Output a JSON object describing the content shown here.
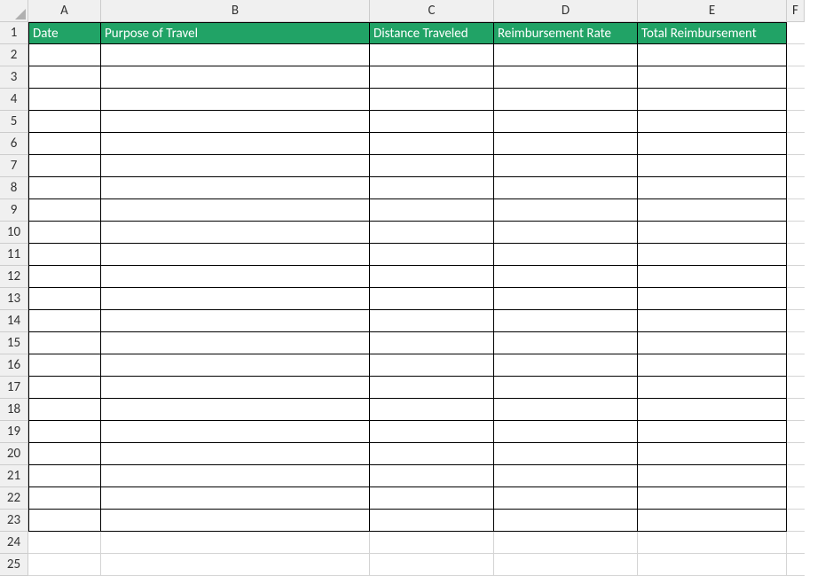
{
  "columns": [
    "A",
    "B",
    "C",
    "D",
    "E",
    "F"
  ],
  "rowCount": 25,
  "dataRowStart": 2,
  "dataRowEnd": 23,
  "headers": {
    "A": "Date",
    "B": "Purpose of Travel",
    "C": "Distance Traveled",
    "D": "Reimbursement Rate",
    "E": "Total Reimbursement"
  },
  "headerBg": "#21a366",
  "headerFg": "#ffffff"
}
